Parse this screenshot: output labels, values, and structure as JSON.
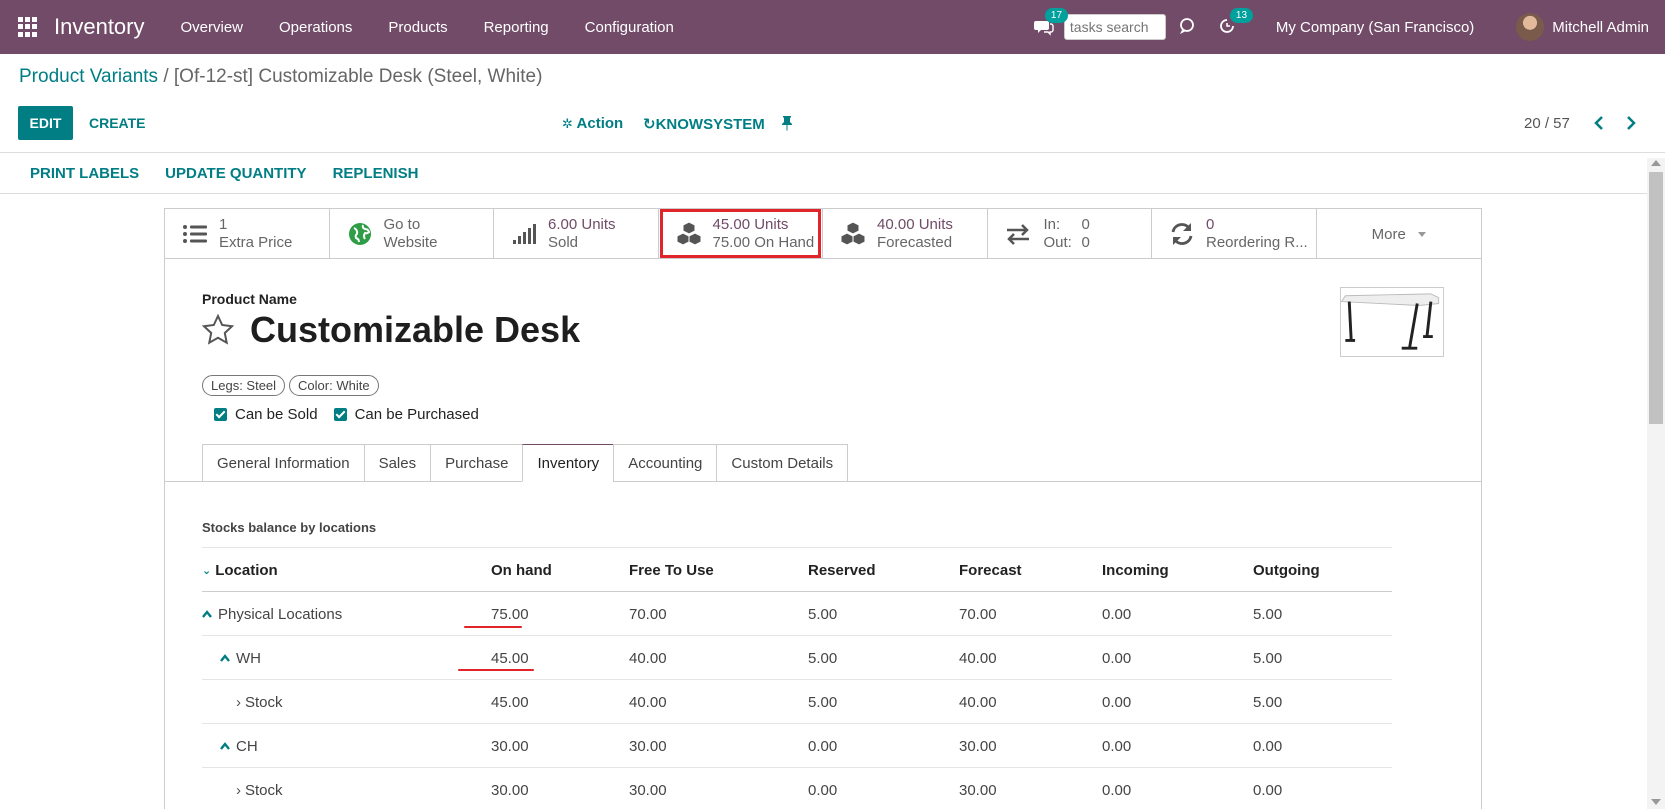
{
  "navbar": {
    "app_title": "Inventory",
    "menu": [
      "Overview",
      "Operations",
      "Products",
      "Reporting",
      "Configuration"
    ],
    "messages_count": "17",
    "task_search_placeholder": "tasks search",
    "activities_count": "13",
    "company": "My Company (San Francisco)",
    "user": "Mitchell Admin"
  },
  "breadcrumb": {
    "parent": "Product Variants",
    "separator": " / ",
    "current": "[Of-12-st] Customizable Desk (Steel, White)"
  },
  "controls": {
    "edit": "EDIT",
    "create": "CREATE",
    "action": "Action",
    "knowsystem": "KNOWSYSTEM",
    "pager": "20 / 57"
  },
  "statusbar": {
    "buttons": [
      "PRINT LABELS",
      "UPDATE QUANTITY",
      "REPLENISH"
    ]
  },
  "smart_buttons": {
    "extra_price": {
      "value": "1",
      "label": "Extra Price"
    },
    "website": {
      "line1": "Go to",
      "line2": "Website"
    },
    "sold": {
      "value": "6.00 Units",
      "label": "Sold"
    },
    "on_hand": {
      "value": "45.00 Units",
      "label": "75.00 On Hand"
    },
    "forecasted": {
      "value": "40.00 Units",
      "label": "Forecasted"
    },
    "in_out": {
      "in_label": "In:",
      "in_value": "0",
      "out_label": "Out:",
      "out_value": "0"
    },
    "reordering": {
      "value": "0",
      "label": "Reordering R..."
    },
    "more": "More"
  },
  "product": {
    "name_label": "Product Name",
    "name": "Customizable Desk",
    "tags": [
      "Legs: Steel",
      "Color: White"
    ],
    "can_be_sold": "Can be Sold",
    "can_be_purchased": "Can be Purchased"
  },
  "tabs": [
    "General Information",
    "Sales",
    "Purchase",
    "Inventory",
    "Accounting",
    "Custom Details"
  ],
  "stock": {
    "title": "Stocks balance by locations",
    "headers": [
      "Location",
      "On hand",
      "Free To Use",
      "Reserved",
      "Forecast",
      "Incoming",
      "Outgoing"
    ],
    "rows": [
      [
        "Physical Locations",
        "75.00",
        "70.00",
        "5.00",
        "70.00",
        "0.00",
        "5.00"
      ],
      [
        "WH",
        "45.00",
        "40.00",
        "5.00",
        "40.00",
        "0.00",
        "5.00"
      ],
      [
        "Stock",
        "45.00",
        "40.00",
        "5.00",
        "40.00",
        "0.00",
        "5.00"
      ],
      [
        "CH",
        "30.00",
        "30.00",
        "0.00",
        "30.00",
        "0.00",
        "0.00"
      ],
      [
        "Stock",
        "30.00",
        "30.00",
        "0.00",
        "30.00",
        "0.00",
        "0.00"
      ]
    ]
  },
  "colors": {
    "navbar": "#714b67",
    "accent": "#017e84",
    "highlight": "#e0242a"
  }
}
